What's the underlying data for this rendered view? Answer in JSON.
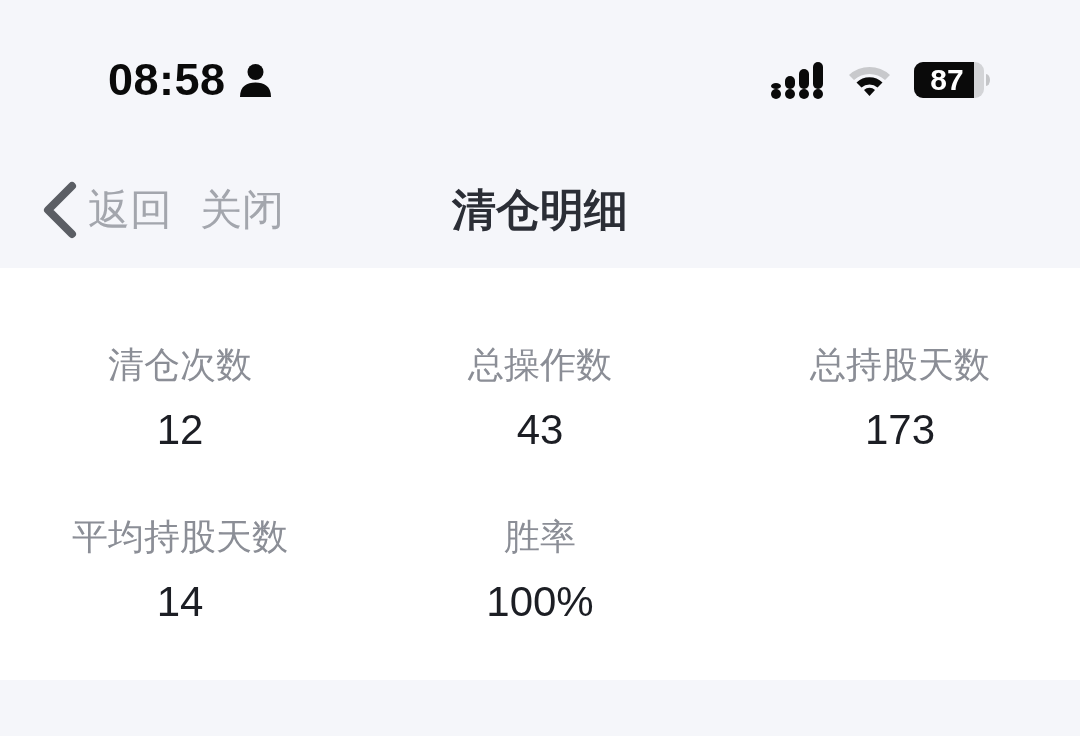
{
  "status_bar": {
    "time": "08:58",
    "battery": "87"
  },
  "nav": {
    "back_label": "返回",
    "close_label": "关闭",
    "title": "清仓明细"
  },
  "stats": [
    {
      "label": "清仓次数",
      "value": "12"
    },
    {
      "label": "总操作数",
      "value": "43"
    },
    {
      "label": "总持股天数",
      "value": "173"
    },
    {
      "label": "平均持股天数",
      "value": "14"
    },
    {
      "label": "胜率",
      "value": "100%"
    }
  ]
}
